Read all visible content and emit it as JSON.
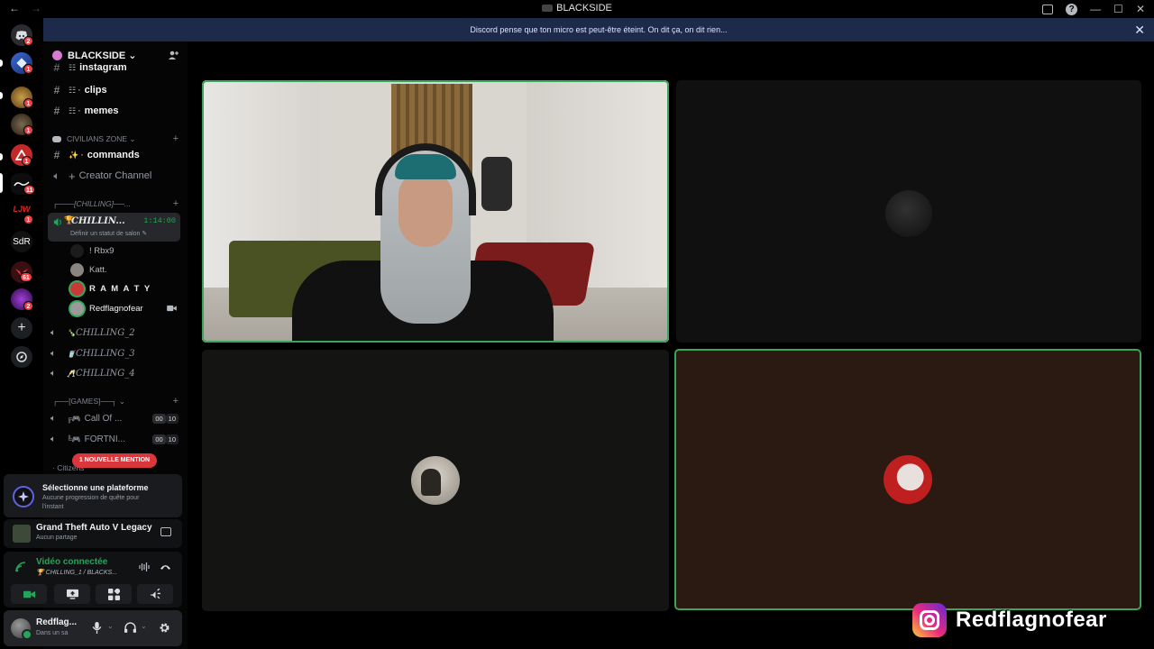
{
  "window": {
    "title": "BLACKSIDE",
    "back": "←",
    "forward": "→",
    "minimize": "—",
    "maximize": "☐",
    "close": "✕"
  },
  "notice": {
    "text": "Discord pense que ton micro est peut-être éteint. On dit ça, on dit rien...",
    "close": "✕"
  },
  "rail": {
    "badges": [
      "2",
      "1",
      "1",
      "1",
      "1",
      "11",
      "1",
      "1",
      "61",
      "2"
    ],
    "sdr_label": "SdR",
    "add_label": "+"
  },
  "sidebar": {
    "server_name": "BLACKSIDE ⌄",
    "channels_top": [
      {
        "icon": "#",
        "emoji": "☷",
        "name": "instagram"
      },
      {
        "icon": "#",
        "emoji": "☷ ·",
        "name": "clips"
      },
      {
        "icon": "#",
        "emoji": "☷ ·",
        "name": "memes"
      }
    ],
    "category_civilians": "CIVILIANS ZONE ⌄",
    "channel_commands": {
      "emoji": "✨ ·",
      "name": "commands"
    },
    "creator_channel": "Creator Channel",
    "category_chilling": "┌───[CHILLING]──...",
    "active_voice": {
      "name": "CHILLIN...",
      "timer": "1:14:00",
      "status": "Définir un statut de salon ✎",
      "trophy": "🏆"
    },
    "members": [
      {
        "name": "! Rbx9"
      },
      {
        "name": "Katt."
      },
      {
        "name": "R A M A T Y"
      },
      {
        "name": "Redflagnofear"
      }
    ],
    "voice_channels": [
      {
        "emoji": "🍾",
        "name": "CHILLING_2"
      },
      {
        "emoji": "🥤",
        "name": "CHILLING_3"
      },
      {
        "emoji": "🥂",
        "name": "CHILLING_4"
      }
    ],
    "category_games": "┌──[GAMES]──┐ ⌄",
    "game_channels": [
      {
        "emoji": "╔🎮",
        "name": "Call Of ...",
        "c1": "00",
        "c2": "10"
      },
      {
        "emoji": "╚🎮",
        "name": "FORTNI...",
        "c1": "00",
        "c2": "10"
      }
    ],
    "mention_pill": "1 NOUVELLE MENTION",
    "hidden_category": "· Citizens"
  },
  "quest": {
    "title": "Sélectionne une plateforme",
    "subtitle": "Aucune progression de quête pour l'instant"
  },
  "activity": {
    "game": "Grand Theft Auto V Legacy",
    "sub": "Aucun partage"
  },
  "voice_panel": {
    "status": "Vidéo connectée",
    "location": "🏆 CHILLING_1 / BLACKS..."
  },
  "user": {
    "name": "Redflag...",
    "status": "Dans un sa"
  },
  "watermark": {
    "handle": "Redflagnofear"
  },
  "colors": {
    "speaking": "#3ba55c",
    "notice_bg": "#1e2a4a",
    "mention": "#da373c",
    "connected": "#23a55a"
  }
}
